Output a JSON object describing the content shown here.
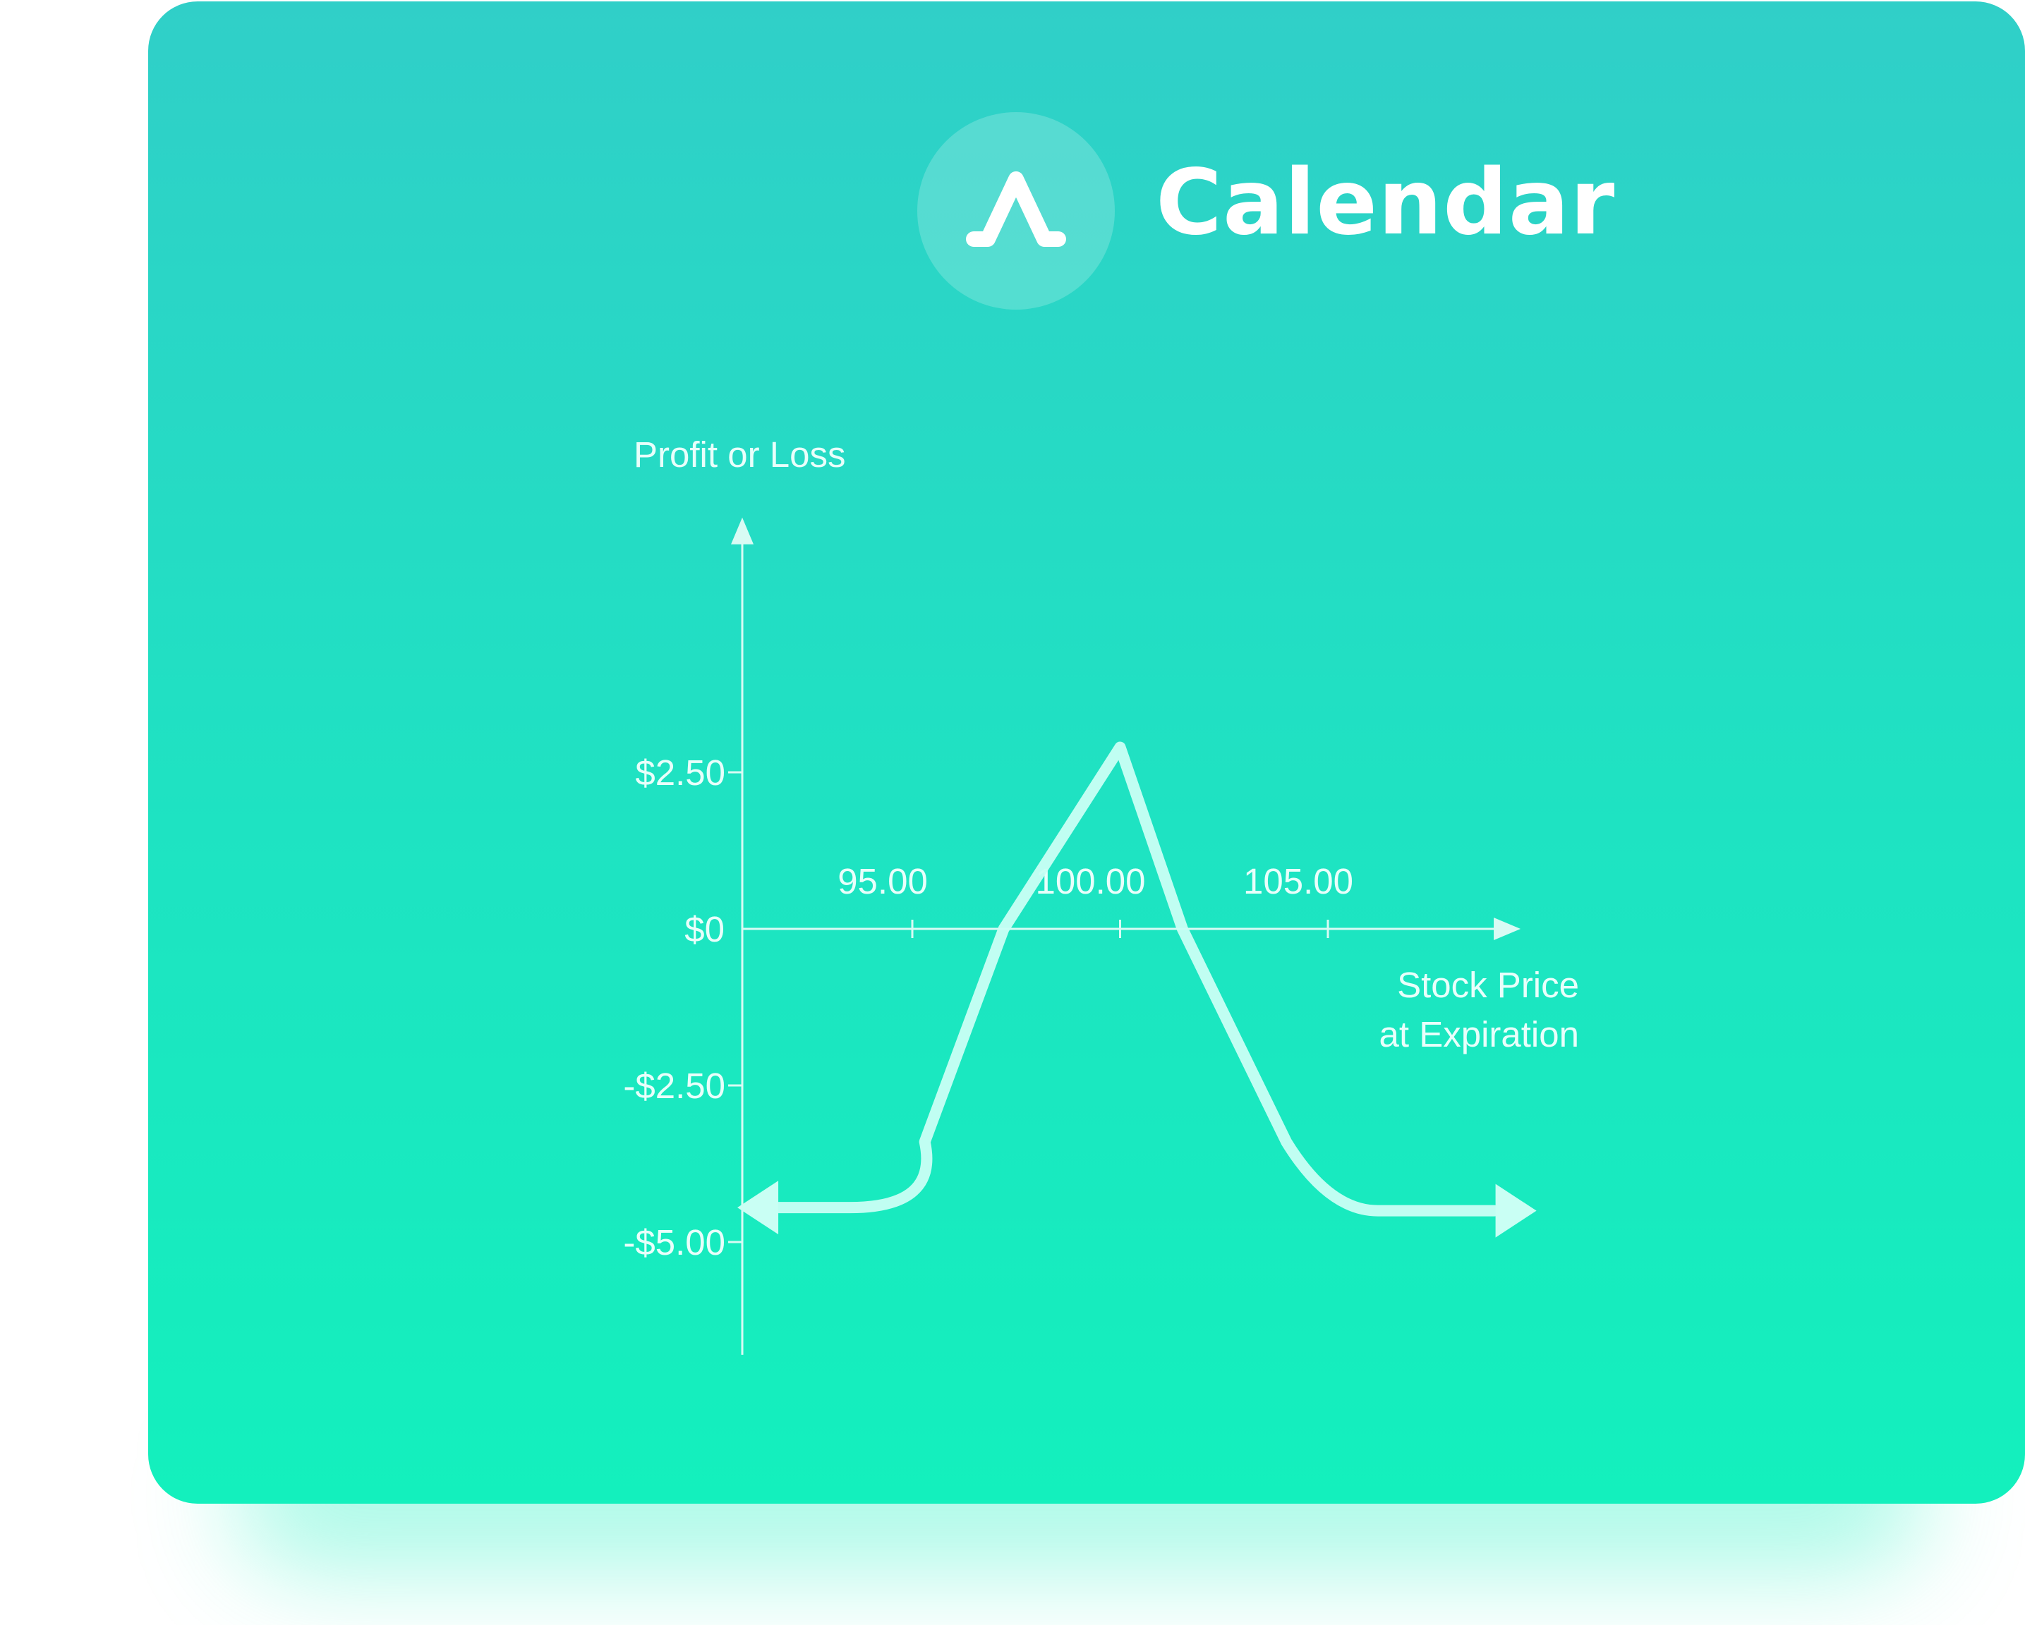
{
  "card": {
    "title": "Calendar",
    "icon": "calendar-spread-payoff-icon",
    "background_top": "#30cfc8",
    "background_bottom": "#13f0bd"
  },
  "chart_data": {
    "type": "line",
    "ylabel": "Profit or Loss",
    "xlabel": "Stock Price at Expiration",
    "xlabel_lines": [
      "Stock Price",
      "at Expiration"
    ],
    "x_ticks": [
      {
        "value": 95,
        "label": "95.00"
      },
      {
        "value": 100,
        "label": "100.00"
      },
      {
        "value": 105,
        "label": "105.00"
      }
    ],
    "y_ticks": [
      {
        "value": 2.5,
        "label": "$2.50"
      },
      {
        "value": 0,
        "label": "$0"
      },
      {
        "value": -2.5,
        "label": "-$2.50"
      },
      {
        "value": -5,
        "label": "-$5.00"
      }
    ],
    "xlim": [
      90.9,
      109.5
    ],
    "ylim": [
      -6.8,
      6.5
    ],
    "series": [
      {
        "x": [
          91.3,
          93.5,
          95.3,
          97.2,
          100.0,
          101.5,
          104.0,
          106.2,
          108.0,
          109.0
        ],
        "y": [
          -4.45,
          -4.45,
          -3.4,
          0.0,
          2.9,
          0.0,
          -3.4,
          -4.5,
          -4.5,
          -4.5
        ]
      }
    ],
    "arrows": [
      "left",
      "right"
    ],
    "line_color": "#c9fff4",
    "axis_color": "#d8fbf4",
    "grid": false
  }
}
